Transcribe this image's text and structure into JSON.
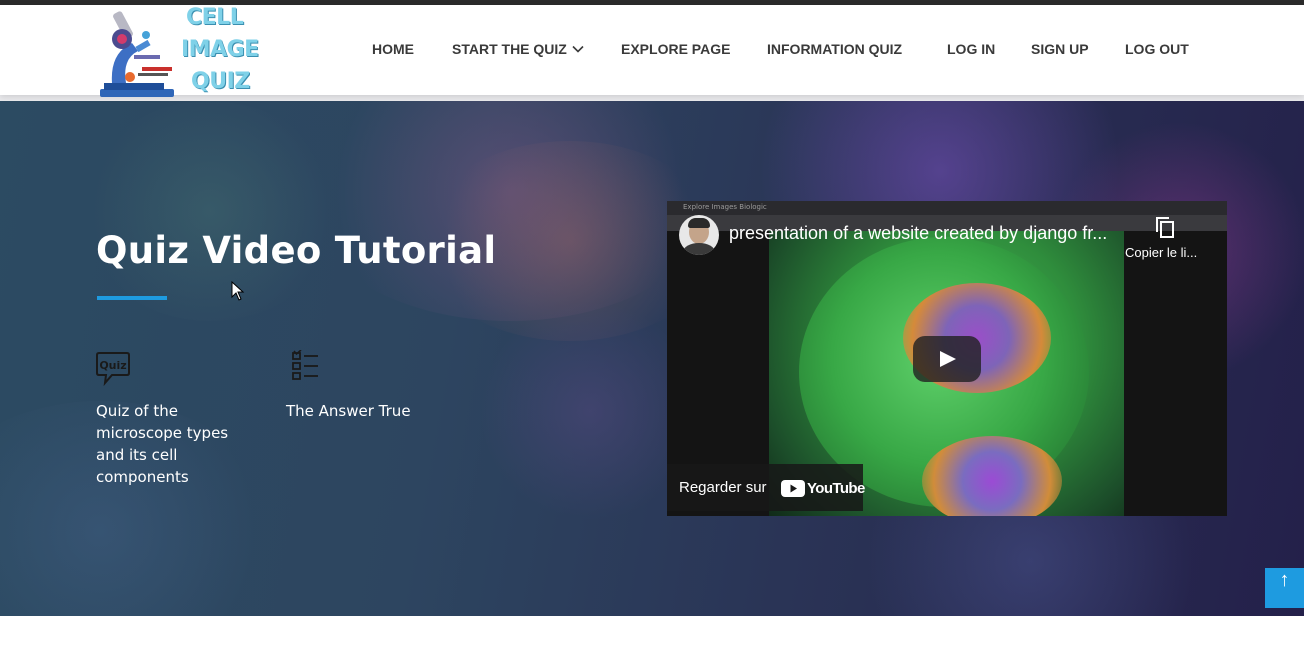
{
  "brand": {
    "logo_lines": [
      "CELL",
      "IMAGE",
      "QUIZ"
    ]
  },
  "nav": {
    "items": [
      {
        "label": "HOME"
      },
      {
        "label": "START THE QUIZ",
        "has_dropdown": true
      },
      {
        "label": "EXPLORE PAGE"
      },
      {
        "label": "INFORMATION QUIZ"
      },
      {
        "label": "LOG IN"
      },
      {
        "label": "SIGN UP"
      },
      {
        "label": "LOG OUT"
      }
    ]
  },
  "hero": {
    "title": "Quiz Video Tutorial",
    "features": [
      {
        "icon": "quiz-bubble-icon",
        "icon_text": "Quiz",
        "text": "Quiz of the microscope types and its cell components"
      },
      {
        "icon": "checklist-icon",
        "text": "The Answer True"
      }
    ]
  },
  "video": {
    "title": "presentation of a website created by django fr...",
    "copy_link_label": "Copier le li...",
    "watch_on_label": "Regarder sur",
    "platform": "YouTube",
    "browser_tab_text": "Explore Images Biologic"
  },
  "scroll_top": {
    "icon": "arrow-up-icon",
    "glyph": "↑"
  },
  "colors": {
    "accent": "#1e9be0",
    "nav_text": "#3a3a3a",
    "hero_bg_start": "#2c4b62",
    "hero_bg_end": "#24204a",
    "logo_text": "#7fd1e8",
    "youtube_red": "#ff0000"
  }
}
